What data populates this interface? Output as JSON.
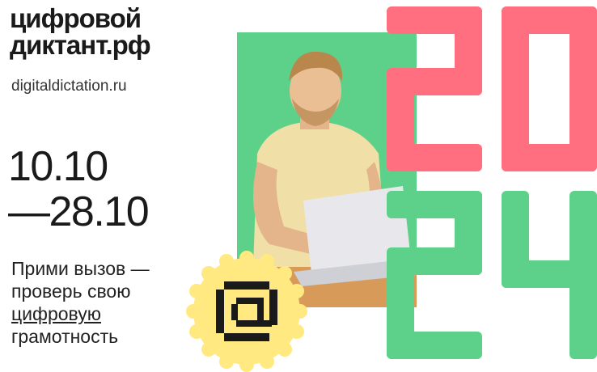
{
  "brand": {
    "line1": "цифровой",
    "line2": "диктант.рф",
    "site": "digitaldictation.ru"
  },
  "dates": {
    "start": "10.10",
    "end": "—28.10"
  },
  "slogan": {
    "line1": "Прими вызов —",
    "line2": "проверь свою",
    "line3": "цифровую",
    "line4": "грамотность"
  },
  "colors": {
    "green": "#5dd18a",
    "pink": "#ff6f7f",
    "yellow": "#ffe980",
    "dark": "#1a1a1a"
  },
  "year_digits": [
    "2",
    "0",
    "2",
    "4"
  ],
  "icon": "at-sign-icon"
}
